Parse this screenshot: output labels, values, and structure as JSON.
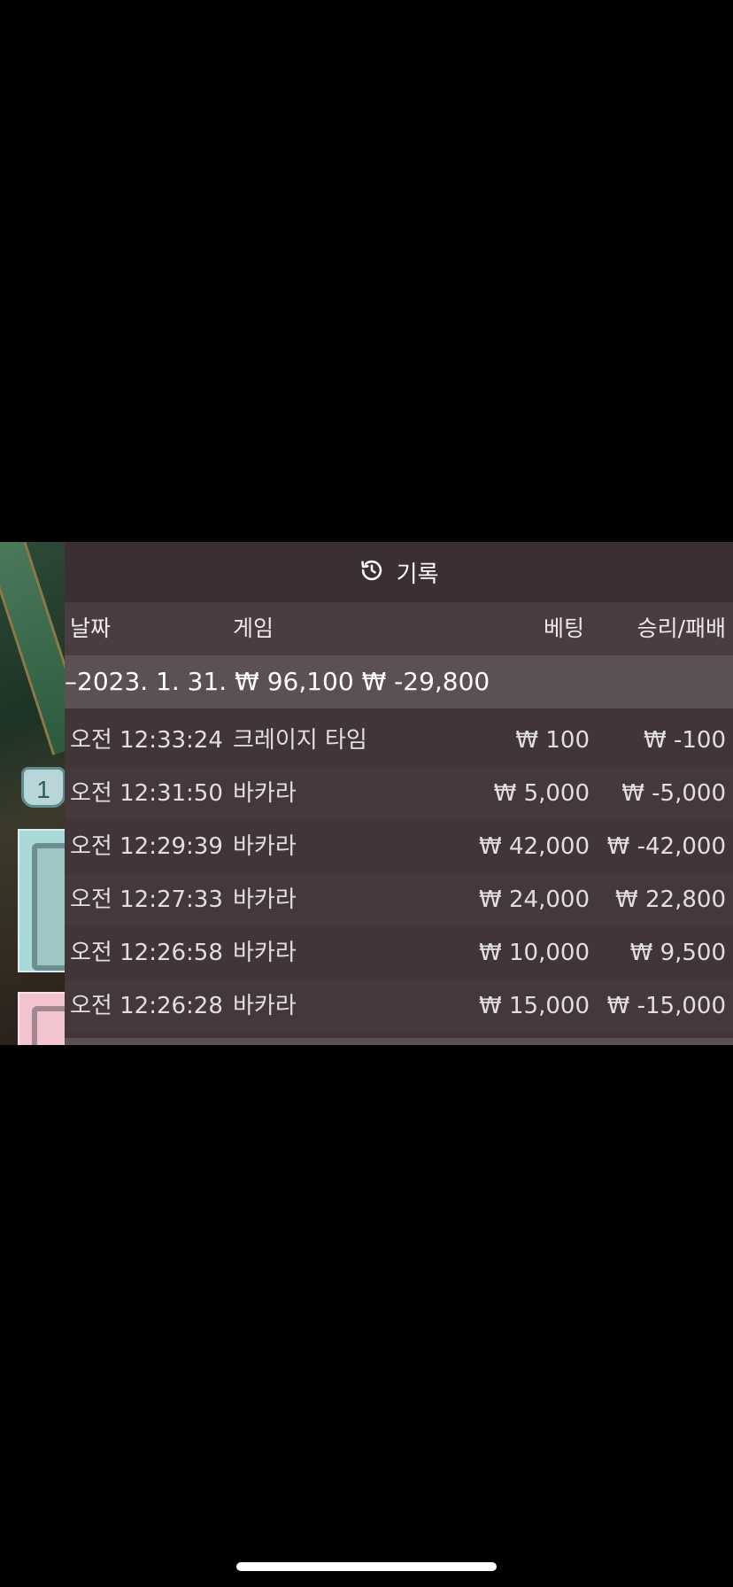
{
  "game_side": {
    "seat_badge": "1"
  },
  "panel": {
    "title": "기록",
    "icon": "history-icon",
    "columns": {
      "date": "날짜",
      "game": "게임",
      "bet": "베팅",
      "win_loss": "승리/패배"
    },
    "date_group": {
      "date": "–2023. 1. 31.",
      "bet_total": "₩ 96,100",
      "win_loss_total": "₩ -29,800"
    },
    "rows": [
      {
        "time": "오전 12:33:24",
        "game": "크레이지 타임",
        "bet": "₩ 100",
        "win_loss": "₩ -100"
      },
      {
        "time": "오전 12:31:50",
        "game": "바카라",
        "bet": "₩ 5,000",
        "win_loss": "₩ -5,000"
      },
      {
        "time": "오전 12:29:39",
        "game": "바카라",
        "bet": "₩ 42,000",
        "win_loss": "₩ -42,000"
      },
      {
        "time": "오전 12:27:33",
        "game": "바카라",
        "bet": "₩ 24,000",
        "win_loss": "₩ 22,800"
      },
      {
        "time": "오전 12:26:58",
        "game": "바카라",
        "bet": "₩ 10,000",
        "win_loss": "₩ 9,500"
      },
      {
        "time": "오전 12:26:28",
        "game": "바카라",
        "bet": "₩ 15,000",
        "win_loss": "₩ -15,000"
      }
    ]
  }
}
